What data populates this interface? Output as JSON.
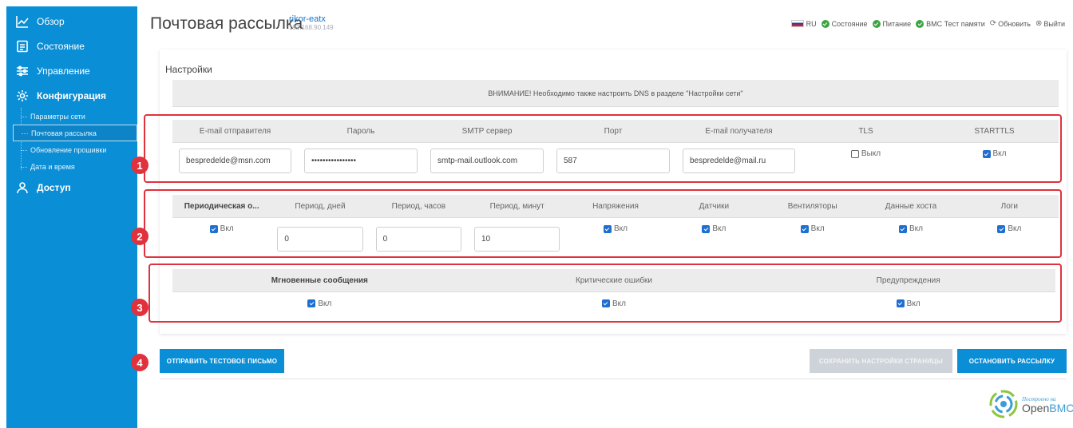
{
  "sidebar": {
    "items": [
      {
        "label": "Обзор",
        "icon": "chart-line-icon"
      },
      {
        "label": "Состояние",
        "icon": "clipboard-icon"
      },
      {
        "label": "Управление",
        "icon": "sliders-icon"
      },
      {
        "label": "Конфигурация",
        "icon": "gear-icon"
      },
      {
        "label": "Доступ",
        "icon": "user-icon"
      }
    ],
    "subitems": [
      "Параметры сети",
      "Почтовая рассылка",
      "Обновление прошивки",
      "Дата и время"
    ]
  },
  "header": {
    "title": "Почтовая рассылка",
    "hostname": "rikor-eatx",
    "ip": "192.168.90.149",
    "status": {
      "lang": "RU",
      "state": "Состояние",
      "power": "Питание",
      "memtest": "BMC Тест памяти",
      "refresh": "Обновить",
      "logout": "Выйти"
    }
  },
  "settings": {
    "title": "Настройки",
    "warning": "ВНИМАНИЕ! Необходимо также настроить DNS в разделе \"Настройки сети\"",
    "section1": {
      "headers": [
        "E-mail отправителя",
        "Пароль",
        "SMTP сервер",
        "Порт",
        "E-mail получателя",
        "TLS",
        "STARTTLS"
      ],
      "sender_email": "bespredelde@msn.com",
      "password": "••••••••••••••••",
      "smtp_server": "smtp-mail.outlook.com",
      "port": "587",
      "recipient_email": "bespredelde@mail.ru",
      "tls_label": "Выкл",
      "starttls_label": "Вкл"
    },
    "section2": {
      "headers": [
        "Периодическая о...",
        "Период, дней",
        "Период, часов",
        "Период, минут",
        "Напряжения",
        "Датчики",
        "Вентиляторы",
        "Данные хоста",
        "Логи"
      ],
      "days": "0",
      "hours": "0",
      "minutes": "10",
      "on_label": "Вкл"
    },
    "section3": {
      "headers": [
        "Мгновенные сообщения",
        "Критические ошибки",
        "Предупреждения"
      ],
      "on_label": "Вкл"
    }
  },
  "markers": [
    "1",
    "2",
    "3",
    "4"
  ],
  "buttons": {
    "send_test": "ОТПРАВИТЬ ТЕСТОВОЕ ПИСЬМО",
    "save": "СОХРАНИТЬ НАСТРОЙКИ СТРАНИЦЫ",
    "stop": "ОСТАНОВИТЬ РАССЫЛКУ"
  },
  "logo": {
    "tagline": "Построено на",
    "name_a": "Open",
    "name_b": "BMC"
  },
  "colors": {
    "sidebar": "#0a8ed6",
    "accent_red": "#e0323d",
    "checkbox": "#1f6fd1",
    "ok_green": "#3aa541"
  }
}
